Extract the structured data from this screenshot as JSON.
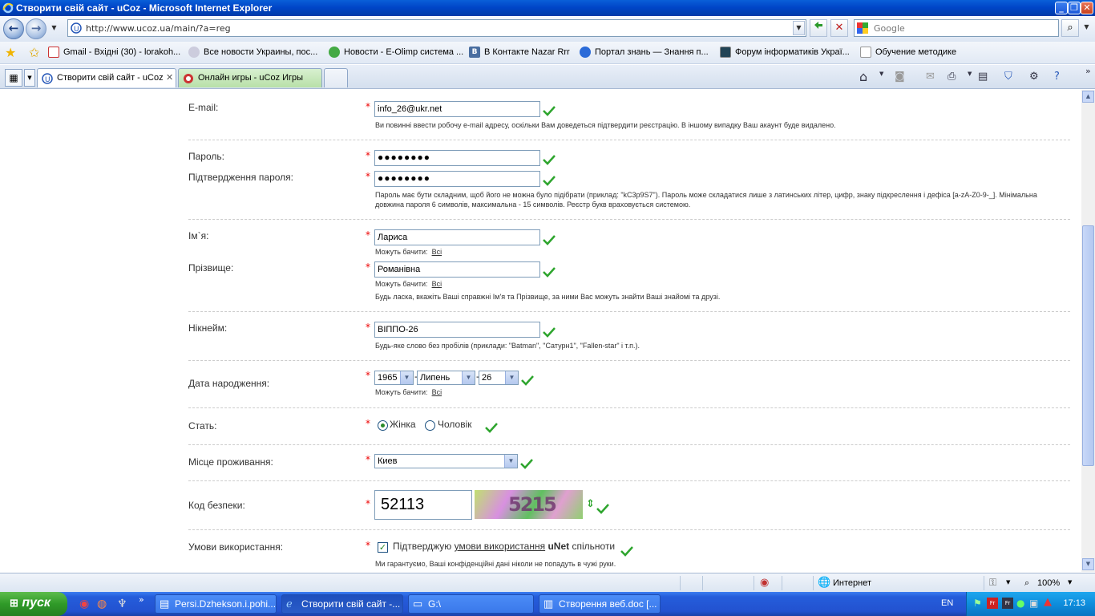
{
  "window": {
    "title": "Створити свій сайт - uCoz - Microsoft Internet Explorer"
  },
  "address_bar": {
    "url": "http://www.ucoz.ua/main/?a=reg",
    "search_placeholder": "Google"
  },
  "favorites": [
    "Gmail - Вхідні (30) - lorakoh...",
    "Все новости Украины, пос...",
    "Новости - E-Olimp система ...",
    "В Контакте  Nazar Rrr",
    "Портал знань — Знання п...",
    "Форум інформатиків Украї...",
    "Обучение методике"
  ],
  "tabs": [
    {
      "label": "Створити свій сайт - uCoz"
    },
    {
      "label": "Онлайн игры - uCoz Игры"
    }
  ],
  "form": {
    "email": {
      "label": "E-mail:",
      "value": "info_26@ukr.net",
      "hint": "Ви повинні ввести робочу e-mail адресу, оскільки Вам доведеться підтвердити реєстрацію. В іншому випадку Ваш акаунт буде видалено."
    },
    "password": {
      "label": "Пароль:",
      "value": "●●●●●●●●",
      "confirm_label": "Підтвердження пароля:",
      "confirm_value": "●●●●●●●●",
      "hint_line1": "Пароль має бути складним, щоб його не можна було підібрати (приклад: \"kC3p9S7\"). Пароль може складатися лише з латинських літер, цифр, знаку підкреслення і дефіса [a-zA-Z0-9-_]. Мінімальна",
      "hint_line2": "довжина пароля 6 символів, максимальна - 15 символів. Реєстр букв враховується системою."
    },
    "first_name": {
      "label": "Ім`я:",
      "value": "Лариса",
      "visibility_label": "Можуть бачити:",
      "visibility_value": "Всі"
    },
    "last_name": {
      "label": "Прізвище:",
      "value": "Романівна",
      "visibility_label": "Можуть бачити:",
      "visibility_value": "Всі",
      "hint": "Будь ласка, вкажіть Ваші справжні Ім'я та Прізвище, за ними Вас можуть знайти Ваші знайомі та друзі."
    },
    "nickname": {
      "label": "Нікнейм:",
      "value": "ВІППО-26",
      "hint": "Будь-яке слово без пробілів (приклади: \"Batman\", \"Сатурн1\", \"Fallen-star\" і т.п.)."
    },
    "birthdate": {
      "label": "Дата народження:",
      "year": "1965",
      "month": "Липень",
      "day": "26",
      "separator": "-",
      "visibility_label": "Можуть бачити:",
      "visibility_value": "Всі"
    },
    "gender": {
      "label": "Стать:",
      "female": "Жінка",
      "male": "Чоловік",
      "selected": "female"
    },
    "residence": {
      "label": "Місце проживання:",
      "value": "Киев"
    },
    "captcha": {
      "label": "Код безпеки:",
      "value": "52113",
      "image_text": "5215"
    },
    "terms": {
      "label": "Умови використання:",
      "prefix": "Підтверджую",
      "link": "умови використання",
      "brand": "uNet",
      "suffix": "спільноти",
      "hint": "Ми гарантуємо, Ваші конфіденційні дані ніколи не попадуть в чужі руки."
    },
    "required_mark": "*"
  },
  "statusbar": {
    "zone": "Интернет",
    "zoom": "100%"
  },
  "taskbar": {
    "start": "пуск",
    "buttons": [
      {
        "label": "Persi.Dzhekson.i.pohi..."
      },
      {
        "label": "Створити свій сайт -..."
      },
      {
        "label": "G:\\"
      },
      {
        "label": "Створення веб.doc [..."
      }
    ],
    "lang": "EN",
    "clock": "17:13"
  },
  "colors": {
    "required": "#e00000",
    "check": "#2ea52e",
    "titlebar": "#0046c8"
  }
}
